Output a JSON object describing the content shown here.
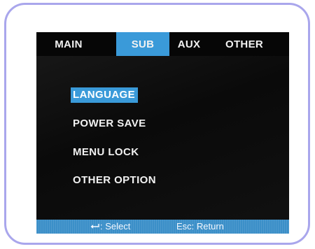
{
  "tabs": [
    {
      "label": "MAIN",
      "active": false
    },
    {
      "label": "SUB",
      "active": true
    },
    {
      "label": "AUX",
      "active": false
    },
    {
      "label": "OTHER",
      "active": false
    }
  ],
  "menu": {
    "items": [
      {
        "label": "LANGUAGE",
        "selected": true
      },
      {
        "label": "POWER SAVE",
        "selected": false
      },
      {
        "label": "MENU LOCK",
        "selected": false
      },
      {
        "label": "OTHER OPTION",
        "selected": false
      }
    ]
  },
  "status": {
    "select_icon": "enter-arrow-icon",
    "select_label": ": Select",
    "return_key": "Esc",
    "return_label": ": Return"
  },
  "colors": {
    "frame_border": "#a9a6ec",
    "highlight": "#3a9ad9",
    "status_bar": "#3b8fc8",
    "screen_bg": "#111111",
    "text": "#f2f2f2"
  }
}
